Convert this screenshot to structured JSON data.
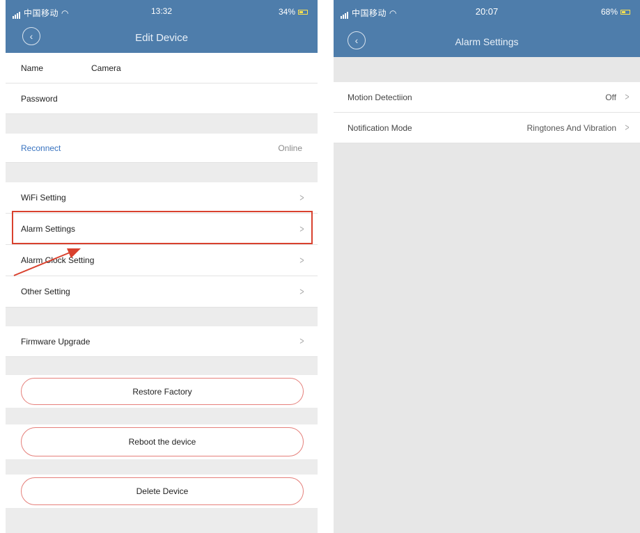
{
  "left": {
    "statusbar": {
      "carrier": "中国移动",
      "time": "13:32",
      "battery": "34%"
    },
    "header": {
      "title": "Edit Device",
      "back_icon": "chevron-left-icon"
    },
    "name_row": {
      "label": "Name",
      "value": "Camera"
    },
    "password_row": {
      "label": "Password"
    },
    "reconnect_row": {
      "label": "Reconnect",
      "status": "Online"
    },
    "menu": [
      {
        "label": "WiFi Setting"
      },
      {
        "label": "Alarm Settings"
      },
      {
        "label": "Alarm Clock Setting"
      },
      {
        "label": "Other Setting"
      }
    ],
    "firmware_row": {
      "label": "Firmware Upgrade"
    },
    "buttons": {
      "restore": "Restore Factory",
      "reboot": "Reboot the device",
      "delete": "Delete Device"
    },
    "annotation_color": "#d9412e"
  },
  "right": {
    "statusbar": {
      "carrier": "中国移动",
      "time": "20:07",
      "battery": "68%"
    },
    "header": {
      "title": "Alarm Settings",
      "back_icon": "chevron-left-icon"
    },
    "rows": [
      {
        "label": "Motion Detectiion",
        "value": "Off"
      },
      {
        "label": "Notification Mode",
        "value": "Ringtones And Vibration"
      }
    ]
  },
  "colors": {
    "header": "#4e7dab",
    "link": "#3a74c0",
    "button_border": "#e57f7a"
  }
}
